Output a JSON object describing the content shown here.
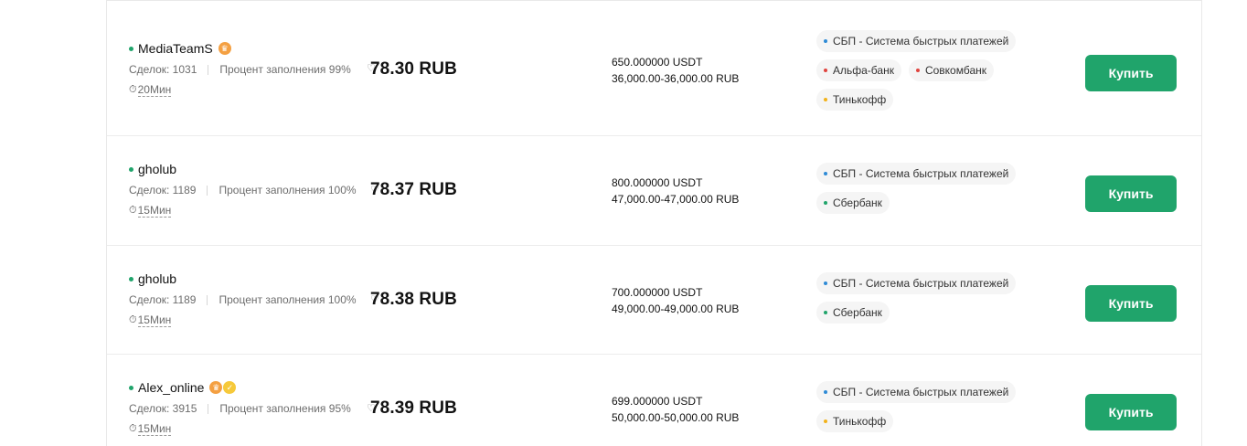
{
  "buy_label": "Купить",
  "colors": {
    "accent_green": "#20a46b",
    "sbp_dot": "#2e8bd6",
    "red_dot": "#e0443f",
    "sber_dot": "#20a46b",
    "tinkoff_dot": "#f2b21b"
  },
  "offers": [
    {
      "name": "MediaTeamS",
      "badges": [
        "crown-icon"
      ],
      "deals": "Сделок: 1031",
      "fill_rate": "Процент заполнения 99%",
      "time": "20Мин",
      "price": "78.30 RUB",
      "amount": "650.000000 USDT",
      "limit": "36,000.00-36,000.00 RUB",
      "methods": [
        [
          {
            "label": "СБП - Система быстрых платежей",
            "dot": "sbp"
          }
        ],
        [
          {
            "label": "Альфа-банк",
            "dot": "red"
          },
          {
            "label": "Совкомбанк",
            "dot": "red"
          }
        ],
        [
          {
            "label": "Тинькофф",
            "dot": "tinkoff"
          }
        ]
      ]
    },
    {
      "name": "gholub",
      "badges": [],
      "deals": "Сделок: 1189",
      "fill_rate": "Процент заполнения 100%",
      "time": "15Мин",
      "price": "78.37 RUB",
      "amount": "800.000000 USDT",
      "limit": "47,000.00-47,000.00 RUB",
      "methods": [
        [
          {
            "label": "СБП - Система быстрых платежей",
            "dot": "sbp"
          }
        ],
        [
          {
            "label": "Сбербанк",
            "dot": "sber"
          }
        ]
      ]
    },
    {
      "name": "gholub",
      "badges": [],
      "deals": "Сделок: 1189",
      "fill_rate": "Процент заполнения 100%",
      "time": "15Мин",
      "price": "78.38 RUB",
      "amount": "700.000000 USDT",
      "limit": "49,000.00-49,000.00 RUB",
      "methods": [
        [
          {
            "label": "СБП - Система быстрых платежей",
            "dot": "sbp"
          }
        ],
        [
          {
            "label": "Сбербанк",
            "dot": "sber"
          }
        ]
      ]
    },
    {
      "name": "Alex_online",
      "badges": [
        "crown-icon",
        "thumbs-up-icon"
      ],
      "deals": "Сделок: 3915",
      "fill_rate": "Процент заполнения 95%",
      "time": "15Мин",
      "price": "78.39 RUB",
      "amount": "699.000000 USDT",
      "limit": "50,000.00-50,000.00 RUB",
      "methods": [
        [
          {
            "label": "СБП - Система быстрых платежей",
            "dot": "sbp"
          }
        ],
        [
          {
            "label": "Тинькофф",
            "dot": "tinkoff"
          }
        ]
      ]
    }
  ]
}
